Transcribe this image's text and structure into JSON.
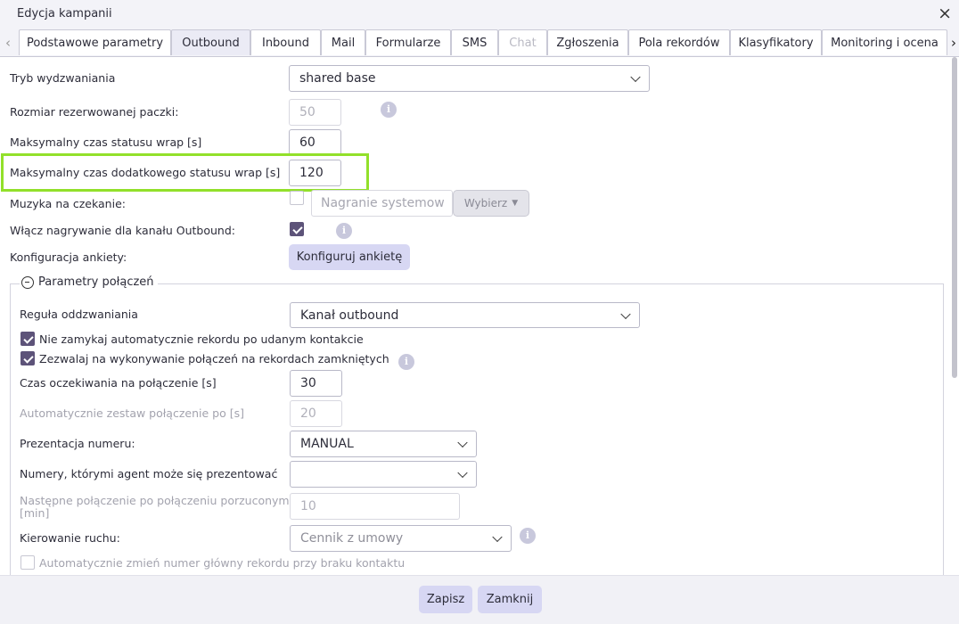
{
  "window": {
    "title": "Edycja kampanii",
    "close_label": "×"
  },
  "tabs": [
    {
      "label": "Podstawowe parametry",
      "state": "normal"
    },
    {
      "label": "Outbound",
      "state": "active"
    },
    {
      "label": "Inbound",
      "state": "normal"
    },
    {
      "label": "Mail",
      "state": "normal"
    },
    {
      "label": "Formularze",
      "state": "normal"
    },
    {
      "label": "SMS",
      "state": "normal"
    },
    {
      "label": "Chat",
      "state": "disabled"
    },
    {
      "label": "Zgłoszenia",
      "state": "normal"
    },
    {
      "label": "Pola rekordów",
      "state": "normal"
    },
    {
      "label": "Klasyfikatory",
      "state": "normal"
    },
    {
      "label": "Monitoring i ocena",
      "state": "normal"
    }
  ],
  "tab_arrows": {
    "left": "‹",
    "right": "›"
  },
  "form": {
    "dialing_mode": {
      "label": "Tryb wydzwaniania",
      "value": "shared base"
    },
    "reserved_batch": {
      "label": "Rozmiar rezerwowanej paczki:",
      "value": "50"
    },
    "max_wrap": {
      "label": "Maksymalny czas statusu wrap [s]",
      "value": "60"
    },
    "max_extra_wrap": {
      "label": "Maksymalny czas dodatkowego statusu wrap [s]",
      "value": "120"
    },
    "hold_music": {
      "label": "Muzyka na czekanie:",
      "placeholder": "Nagranie systemow",
      "choose_label": "Wybierz"
    },
    "record_outbound": {
      "label": "Włącz nagrywanie dla kanału Outbound:",
      "checked": true
    },
    "survey_config": {
      "label": "Konfiguracja ankiety:",
      "button_label": "Konfiguruj ankietę"
    }
  },
  "connection_params": {
    "legend": "Parametry połączeń",
    "callback_rule": {
      "label": "Reguła oddzwaniania",
      "value": "Kanał outbound"
    },
    "no_auto_close": {
      "label": "Nie zamykaj automatycznie rekordu po udanym kontakcie",
      "checked": true
    },
    "allow_closed": {
      "label": "Zezwalaj na wykonywanie połączeń na rekordach zamkniętych",
      "checked": true
    },
    "wait_time": {
      "label": "Czas oczekiwania na połączenie [s]",
      "value": "30"
    },
    "auto_connect": {
      "label": "Automatycznie zestaw połączenie po [s]",
      "value": "20"
    },
    "number_presentation": {
      "label": "Prezentacja numeru:",
      "value": "MANUAL"
    },
    "agent_numbers": {
      "label": "Numery, którymi agent może się prezentować",
      "value": ""
    },
    "next_after_abandon": {
      "label_line1": "Następne połączenie po połączeniu porzuconym",
      "label_line2": "[min]",
      "value": "10"
    },
    "traffic_routing": {
      "label": "Kierowanie ruchu:",
      "value": "Cennik z umowy"
    },
    "auto_change_main": {
      "label": "Automatycznie zmień numer główny rekordu przy braku kontaktu",
      "checked": false
    }
  },
  "footer": {
    "save_label": "Zapisz",
    "close_label": "Zamknij"
  },
  "colors": {
    "highlight": "#92e02a",
    "checkbox": "#5d5379",
    "button": "#d7d7f3"
  }
}
